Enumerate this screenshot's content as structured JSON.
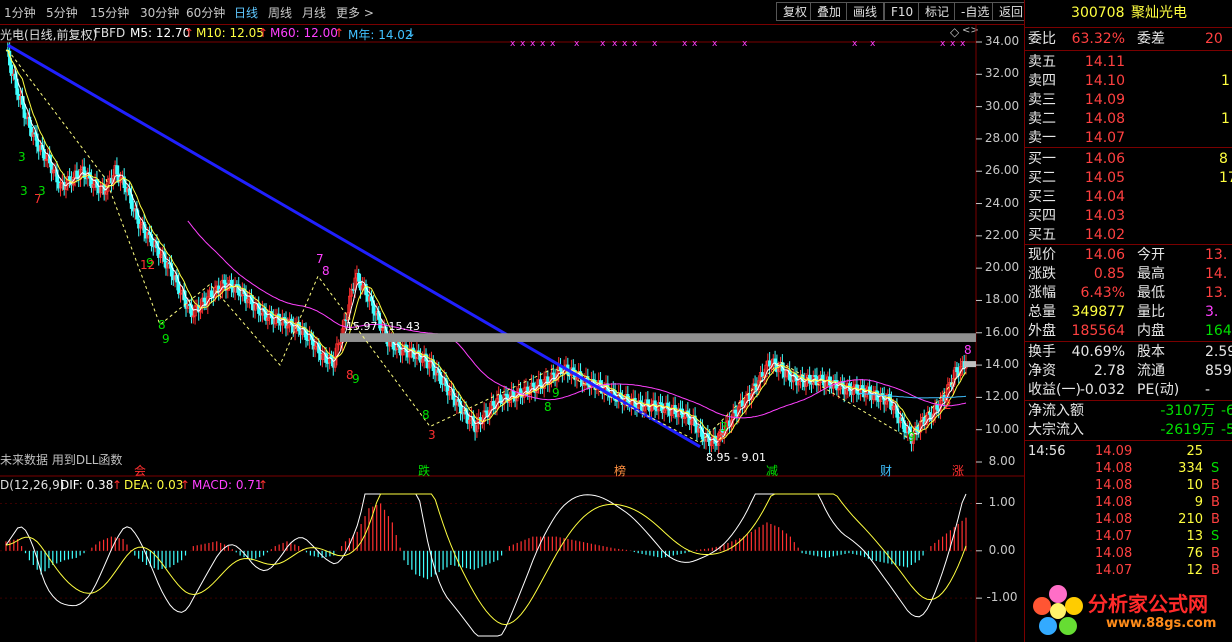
{
  "toolbar": {
    "periods": [
      "1分钟",
      "5分钟",
      "15分钟",
      "30分钟",
      "60分钟",
      "日线",
      "周线",
      "月线",
      "更多 >"
    ],
    "active_period": "日线",
    "buttons": [
      "复权",
      "叠加",
      "画线",
      "F10",
      "标记",
      "-自选",
      "返回"
    ]
  },
  "main_legend": {
    "title": "光电(日线,前复权)",
    "indicator": "FBFD",
    "ma5": "M5: 12.70",
    "ma10": "M10: 12.05",
    "ma60": "M60: 12.00",
    "myear": "M年: 14.02",
    "arrow_up": "↑",
    "arrow_down": "↓"
  },
  "price_axis": [
    "34.00",
    "32.00",
    "30.00",
    "28.00",
    "26.00",
    "24.00",
    "22.00",
    "20.00",
    "18.00",
    "16.00",
    "14.00",
    "12.00",
    "10.00",
    "8.00"
  ],
  "macd_axis": [
    "1.00",
    "0.00",
    "-1.00"
  ],
  "macd_legend": {
    "name": "D(12,26,9)",
    "dif": "DIF: 0.38",
    "dea": "DEA: 0.03",
    "macd": "MACD: 0.71",
    "arrow_up": "↑"
  },
  "annotations": {
    "range_high": "15.97 - 15.43",
    "range_low": "8.95 - 9.01",
    "dll_note": "未来数据 用到DLL函数",
    "bottom_markers": [
      "会",
      "跌",
      "榜",
      "减",
      "财",
      "涨"
    ],
    "peak_label_a": "7",
    "peak_label_b": "8",
    "count_labels": [
      "3",
      "3",
      "7",
      "3",
      "9",
      "12",
      "8",
      "9",
      "8",
      "9",
      "8",
      "3",
      "8",
      "9",
      "8",
      "3",
      "9",
      "2"
    ],
    "chevron": "◇",
    "dots_left": "<>"
  },
  "stock": {
    "code": "300708",
    "name": "聚灿光电"
  },
  "orderbook_header": {
    "label1": "委比",
    "val1": "63.32%",
    "label2": "委差",
    "val2": "20"
  },
  "asks": [
    {
      "label": "卖五",
      "price": "14.11",
      "vol": ""
    },
    {
      "label": "卖四",
      "price": "14.10",
      "vol": "1"
    },
    {
      "label": "卖三",
      "price": "14.09",
      "vol": ""
    },
    {
      "label": "卖二",
      "price": "14.08",
      "vol": "1"
    },
    {
      "label": "卖一",
      "price": "14.07",
      "vol": ""
    }
  ],
  "bids": [
    {
      "label": "买一",
      "price": "14.06",
      "vol": "8"
    },
    {
      "label": "买二",
      "price": "14.05",
      "vol": "17"
    },
    {
      "label": "买三",
      "price": "14.04",
      "vol": ""
    },
    {
      "label": "买四",
      "price": "14.03",
      "vol": ""
    },
    {
      "label": "买五",
      "price": "14.02",
      "vol": ""
    }
  ],
  "quote": [
    {
      "l1": "现价",
      "v1": "14.06",
      "c1": "red",
      "l2": "今开",
      "v2": "13.",
      "c2": "red"
    },
    {
      "l1": "涨跌",
      "v1": "0.85",
      "c1": "red",
      "l2": "最高",
      "v2": "14.",
      "c2": "red"
    },
    {
      "l1": "涨幅",
      "v1": "6.43%",
      "c1": "red",
      "l2": "最低",
      "v2": "13.",
      "c2": "red"
    },
    {
      "l1": "总量",
      "v1": "349877",
      "c1": "yel",
      "l2": "量比",
      "v2": "3.",
      "c2": "mag"
    },
    {
      "l1": "外盘",
      "v1": "185564",
      "c1": "red",
      "l2": "内盘",
      "v2": "1643",
      "c2": "green"
    }
  ],
  "fundamentals": [
    {
      "l1": "换手",
      "v1": "40.69%",
      "l2": "股本",
      "v2": "2.59"
    },
    {
      "l1": "净资",
      "v1": "2.78",
      "l2": "流通",
      "v2": "8599"
    },
    {
      "l1": "收益(一)",
      "v1": "-0.032",
      "l2": "PE(动)",
      "v2": "-"
    }
  ],
  "flows": [
    {
      "label": "净流入额",
      "value": "-3107万",
      "tail": "-6"
    },
    {
      "label": "大宗流入",
      "value": "-2619万",
      "tail": "-5"
    }
  ],
  "ticks": [
    {
      "time": "14:56",
      "price": "14.09",
      "vol": "25",
      "side": ""
    },
    {
      "time": "",
      "price": "14.08",
      "vol": "334",
      "side": "S"
    },
    {
      "time": "",
      "price": "14.08",
      "vol": "10",
      "side": "B"
    },
    {
      "time": "",
      "price": "14.08",
      "vol": "9",
      "side": "B"
    },
    {
      "time": "",
      "price": "14.08",
      "vol": "210",
      "side": "B"
    },
    {
      "time": "",
      "price": "14.07",
      "vol": "13",
      "side": "S"
    },
    {
      "time": "",
      "price": "14.08",
      "vol": "76",
      "side": "B"
    },
    {
      "time": "",
      "price": "14.07",
      "vol": "12",
      "side": "B"
    }
  ],
  "watermark": {
    "title": "分析家公式网",
    "url": "www.88gs.com"
  },
  "colors": {
    "up": "#ff3030",
    "down": "#40ffff",
    "ma5": "#ffffff",
    "ma10": "#ffff40",
    "ma60": "#ff40ff",
    "myear": "#40c0ff",
    "trendline": "#2020ff",
    "grid": "#7a0000"
  },
  "chart_data": {
    "type": "candlestick",
    "price_ylim": [
      8,
      34
    ],
    "price_series": [
      33.5,
      31,
      29,
      27.5,
      26.5,
      25,
      25.5,
      26,
      25.2,
      24.8,
      26,
      25,
      23,
      22,
      21,
      20,
      18.5,
      17.2,
      17.8,
      18.5,
      19,
      18.8,
      18.2,
      17.5,
      17,
      16.8,
      16.5,
      16.2,
      15.5,
      14.5,
      14.2,
      16.5,
      19.5,
      18.5,
      17,
      15.5,
      15,
      14.8,
      14.5,
      14,
      13,
      12,
      11,
      10.2,
      11,
      11.8,
      12,
      12.2,
      12.5,
      12.8,
      13.2,
      13.8,
      13.5,
      13,
      12.8,
      12.5,
      12,
      11.8,
      11.5,
      11.5,
      11.4,
      11.2,
      11,
      10.5,
      9.5,
      9.2,
      10.2,
      11.2,
      12,
      13,
      14.2,
      13.8,
      13.2,
      13,
      13.1,
      13,
      12.8,
      12.5,
      12.5,
      12.3,
      12,
      11.8,
      10.5,
      9.5,
      10.5,
      11,
      12,
      13.5,
      14.1
    ],
    "macd_ylim": [
      -1.8,
      1.2
    ],
    "macd_hist": [
      0.2,
      0.25,
      -0.2,
      -0.5,
      -0.3,
      -0.2,
      -0.15,
      0,
      0.2,
      0.3,
      0.25,
      -0.1,
      -0.3,
      -0.4,
      -0.35,
      -0.2,
      0.1,
      0.15,
      0.2,
      0.1,
      -0.1,
      -0.2,
      -0.1,
      0.1,
      0.2,
      0.1,
      -0.1,
      -0.15,
      -0.1,
      0.2,
      0.4,
      0.9,
      1.0,
      0.6,
      -0.2,
      -0.5,
      -0.6,
      -0.45,
      -0.3,
      -0.35,
      -0.4,
      -0.3,
      -0.2,
      0.1,
      0.2,
      0.3,
      0.3,
      0.3,
      0.25,
      0.2,
      0.15,
      0.1,
      0.05,
      0.02,
      -0.05,
      -0.1,
      -0.15,
      -0.1,
      -0.05,
      0.02,
      0.05,
      0.1,
      0.2,
      0.3,
      0.45,
      0.6,
      0.5,
      0.3,
      -0.05,
      -0.1,
      -0.15,
      -0.1,
      -0.05,
      -0.1,
      -0.2,
      -0.25,
      -0.3,
      -0.35,
      -0.2,
      0.1,
      0.3,
      0.5,
      0.7
    ]
  }
}
